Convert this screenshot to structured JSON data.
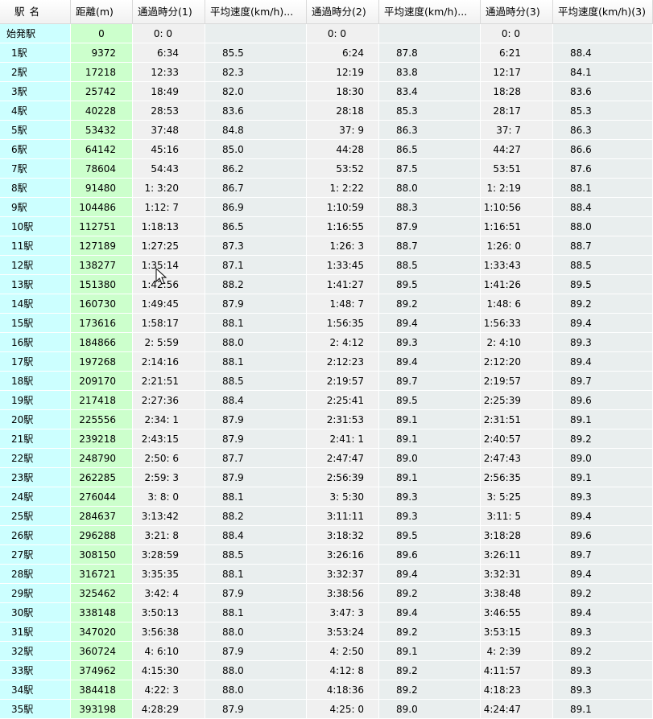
{
  "columns": [
    "駅 名",
    "距離(m)",
    "通過時分(1)",
    "平均速度(km/h)...",
    "通過時分(2)",
    "平均速度(km/h)...",
    "通過時分(3)",
    "平均速度(km/h)(3)"
  ],
  "rows": [
    [
      "始発駅",
      "0",
      "0: 0",
      "",
      "0: 0",
      "",
      "0: 0",
      ""
    ],
    [
      "1駅",
      "9372",
      "6:34",
      "85.5",
      "6:24",
      "87.8",
      "6:21",
      "88.4"
    ],
    [
      "2駅",
      "17218",
      "12:33",
      "82.3",
      "12:19",
      "83.8",
      "12:17",
      "84.1"
    ],
    [
      "3駅",
      "25742",
      "18:49",
      "82.0",
      "18:30",
      "83.4",
      "18:28",
      "83.6"
    ],
    [
      "4駅",
      "40228",
      "28:53",
      "83.6",
      "28:18",
      "85.3",
      "28:17",
      "85.3"
    ],
    [
      "5駅",
      "53432",
      "37:48",
      "84.8",
      "37: 9",
      "86.3",
      "37: 7",
      "86.3"
    ],
    [
      "6駅",
      "64142",
      "45:16",
      "85.0",
      "44:28",
      "86.5",
      "44:27",
      "86.6"
    ],
    [
      "7駅",
      "78604",
      "54:43",
      "86.2",
      "53:52",
      "87.5",
      "53:51",
      "87.6"
    ],
    [
      "8駅",
      "91480",
      "1: 3:20",
      "86.7",
      "1: 2:22",
      "88.0",
      "1: 2:19",
      "88.1"
    ],
    [
      "9駅",
      "104486",
      "1:12: 7",
      "86.9",
      "1:10:59",
      "88.3",
      "1:10:56",
      "88.4"
    ],
    [
      "10駅",
      "112751",
      "1:18:13",
      "86.5",
      "1:16:55",
      "87.9",
      "1:16:51",
      "88.0"
    ],
    [
      "11駅",
      "127189",
      "1:27:25",
      "87.3",
      "1:26: 3",
      "88.7",
      "1:26: 0",
      "88.7"
    ],
    [
      "12駅",
      "138277",
      "1:35:14",
      "87.1",
      "1:33:45",
      "88.5",
      "1:33:43",
      "88.5"
    ],
    [
      "13駅",
      "151380",
      "1:42:56",
      "88.2",
      "1:41:27",
      "89.5",
      "1:41:26",
      "89.5"
    ],
    [
      "14駅",
      "160730",
      "1:49:45",
      "87.9",
      "1:48: 7",
      "89.2",
      "1:48: 6",
      "89.2"
    ],
    [
      "15駅",
      "173616",
      "1:58:17",
      "88.1",
      "1:56:35",
      "89.4",
      "1:56:33",
      "89.4"
    ],
    [
      "16駅",
      "184866",
      "2: 5:59",
      "88.0",
      "2: 4:12",
      "89.3",
      "2: 4:10",
      "89.3"
    ],
    [
      "17駅",
      "197268",
      "2:14:16",
      "88.1",
      "2:12:23",
      "89.4",
      "2:12:20",
      "89.4"
    ],
    [
      "18駅",
      "209170",
      "2:21:51",
      "88.5",
      "2:19:57",
      "89.7",
      "2:19:57",
      "89.7"
    ],
    [
      "19駅",
      "217418",
      "2:27:36",
      "88.4",
      "2:25:41",
      "89.5",
      "2:25:39",
      "89.6"
    ],
    [
      "20駅",
      "225556",
      "2:34: 1",
      "87.9",
      "2:31:53",
      "89.1",
      "2:31:51",
      "89.1"
    ],
    [
      "21駅",
      "239218",
      "2:43:15",
      "87.9",
      "2:41: 1",
      "89.1",
      "2:40:57",
      "89.2"
    ],
    [
      "22駅",
      "248790",
      "2:50: 6",
      "87.7",
      "2:47:47",
      "89.0",
      "2:47:43",
      "89.0"
    ],
    [
      "23駅",
      "262285",
      "2:59: 3",
      "87.9",
      "2:56:39",
      "89.1",
      "2:56:35",
      "89.1"
    ],
    [
      "24駅",
      "276044",
      "3: 8: 0",
      "88.1",
      "3: 5:30",
      "89.3",
      "3: 5:25",
      "89.3"
    ],
    [
      "25駅",
      "284637",
      "3:13:42",
      "88.2",
      "3:11:11",
      "89.3",
      "3:11: 5",
      "89.4"
    ],
    [
      "26駅",
      "296288",
      "3:21: 8",
      "88.4",
      "3:18:32",
      "89.5",
      "3:18:28",
      "89.6"
    ],
    [
      "27駅",
      "308150",
      "3:28:59",
      "88.5",
      "3:26:16",
      "89.6",
      "3:26:11",
      "89.7"
    ],
    [
      "28駅",
      "316721",
      "3:35:35",
      "88.1",
      "3:32:37",
      "89.4",
      "3:32:31",
      "89.4"
    ],
    [
      "29駅",
      "325462",
      "3:42: 4",
      "87.9",
      "3:38:56",
      "89.2",
      "3:38:48",
      "89.2"
    ],
    [
      "30駅",
      "338148",
      "3:50:13",
      "88.1",
      "3:47: 3",
      "89.4",
      "3:46:55",
      "89.4"
    ],
    [
      "31駅",
      "347020",
      "3:56:38",
      "88.0",
      "3:53:24",
      "89.2",
      "3:53:15",
      "89.3"
    ],
    [
      "32駅",
      "360724",
      "4: 6:10",
      "87.9",
      "4: 2:50",
      "89.1",
      "4: 2:39",
      "89.2"
    ],
    [
      "33駅",
      "374962",
      "4:15:30",
      "88.0",
      "4:12: 8",
      "89.2",
      "4:11:57",
      "89.3"
    ],
    [
      "34駅",
      "384418",
      "4:22: 3",
      "88.0",
      "4:18:36",
      "89.2",
      "4:18:23",
      "89.3"
    ],
    [
      "35駅",
      "393198",
      "4:28:29",
      "87.9",
      "4:25: 0",
      "89.0",
      "4:24:47",
      "89.1"
    ]
  ],
  "cursor": "mouse-pointer-icon"
}
